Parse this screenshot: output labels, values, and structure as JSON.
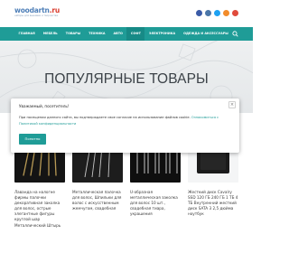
{
  "header": {
    "logo_main": "woodartn",
    "logo_tld": ".ru",
    "logo_tagline": "наборы для вышивки и творчества",
    "social_icons": [
      "facebook-icon",
      "vk-icon",
      "twitter-icon",
      "rss-icon",
      "youtube-icon"
    ]
  },
  "nav": {
    "items": [
      {
        "label": "ГЛАВНАЯ",
        "active": false
      },
      {
        "label": "МЕБЕЛЬ",
        "active": false
      },
      {
        "label": "ТОВАРЫ",
        "active": false
      },
      {
        "label": "ТЕХНИКА",
        "active": false
      },
      {
        "label": "АВТО",
        "active": false
      },
      {
        "label": "СОФТ",
        "active": true
      },
      {
        "label": "ЭЛЕКТРОНИКА",
        "active": false
      },
      {
        "label": "ОДЕЖДА И АКСЕССУАРЫ",
        "active": false
      }
    ],
    "search_icon": "search-icon",
    "bar_color": "#1f9c97"
  },
  "hero": {
    "title": "ПОПУЛЯРНЫЕ ТОВАРЫ"
  },
  "products": [
    {
      "title": "Лаванда на налогне фирмы палочки декоративная заколка для волос, острые элегантные фигуры круглой шар Металлический Штырь"
    },
    {
      "title": "Металлическая палочка для волос, Шпильки для волос с искусственным жемчугом, свадебная"
    },
    {
      "title": "U-образная металлическая заколка для волос 10 шт., свадебная тиара, украшения"
    },
    {
      "title": "Жесткий диск Cavalry SSD 120 ГБ 240 ГБ 1 ТБ 4 ТБ Внутренний жесткий диск SATA 3 2,5 дюйма ноутбук"
    }
  ],
  "cookie": {
    "heading": "Уважаемый, посетитель!",
    "text": "При посещении данного сайта, вы подтверждаете свое согласие на использование файлов cookie.",
    "link": "Ознакомиться с Политикой конфиденциальности",
    "ok_label": "Понятно",
    "close_glyph": "×"
  }
}
